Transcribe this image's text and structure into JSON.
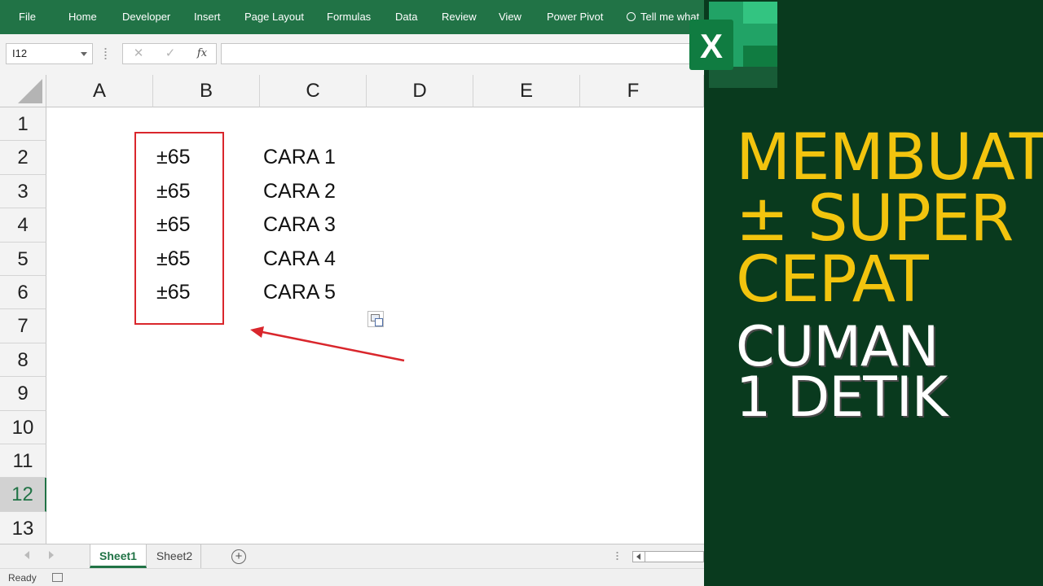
{
  "ribbon": {
    "tabs": [
      "File",
      "Home",
      "Developer",
      "Insert",
      "Page Layout",
      "Formulas",
      "Data",
      "Review",
      "View",
      "Power Pivot"
    ],
    "tell_me": "Tell me what"
  },
  "formula_bar": {
    "name_box": "I12",
    "cancel_icon": "✕",
    "enter_icon": "✓",
    "fx_label": "fx",
    "formula_value": ""
  },
  "columns": [
    "A",
    "B",
    "C",
    "D",
    "E",
    "F"
  ],
  "rows": [
    "1",
    "2",
    "3",
    "4",
    "5",
    "6",
    "7",
    "8",
    "9",
    "10",
    "11",
    "12",
    "13"
  ],
  "selected_row": "12",
  "cells": {
    "B2": "±65",
    "B3": "±65",
    "B4": "±65",
    "B5": "±65",
    "B6": "±65",
    "C2": "CARA 1",
    "C3": "CARA 2",
    "C4": "CARA 3",
    "C5": "CARA 4",
    "C6": "CARA 5"
  },
  "sheets": [
    "Sheet1",
    "Sheet2"
  ],
  "active_sheet": "Sheet1",
  "add_sheet_icon": "+",
  "status": "Ready",
  "logo_letter": "X",
  "headline": {
    "line1": "MEMBUAT",
    "line2": "± SUPER",
    "line3": "CEPAT",
    "line4": "CUMAN",
    "line5": "1 DETIK"
  },
  "colors": {
    "excel_green": "#217346",
    "panel_bg": "#093a1e",
    "headline_yellow": "#f2c40e",
    "highlight_red": "#d9262c"
  }
}
